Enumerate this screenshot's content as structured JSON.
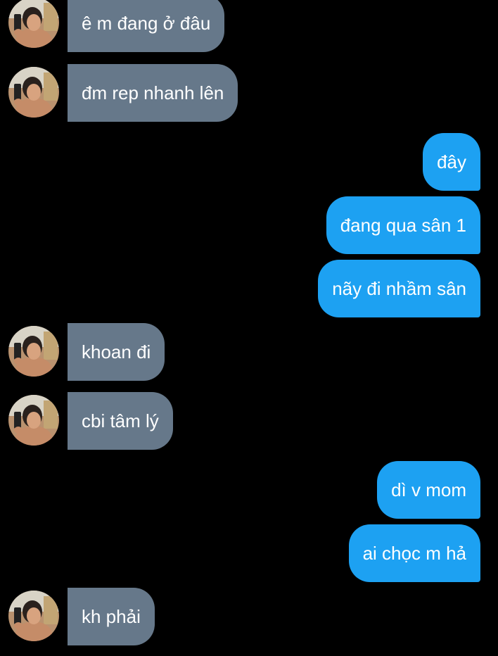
{
  "conversation": {
    "messages": [
      {
        "side": "received",
        "text": "ê m đang ở đâu"
      },
      {
        "side": "received",
        "text": "đm rep nhanh lên"
      },
      {
        "side": "sent",
        "text": "đây"
      },
      {
        "side": "sent",
        "text": "đang qua sân 1"
      },
      {
        "side": "sent",
        "text": "nãy đi nhầm sân"
      },
      {
        "side": "received",
        "text": "khoan đi"
      },
      {
        "side": "received",
        "text": "cbi tâm lý"
      },
      {
        "side": "sent",
        "text": "dì v mom"
      },
      {
        "side": "sent",
        "text": "ai chọc m hả"
      },
      {
        "side": "received",
        "text": "kh phải"
      }
    ]
  },
  "colors": {
    "background": "#000000",
    "received_bubble": "#66788a",
    "sent_bubble": "#1da1f2",
    "text": "#ffffff"
  },
  "icons": {
    "avatar": "user-avatar-photo"
  }
}
